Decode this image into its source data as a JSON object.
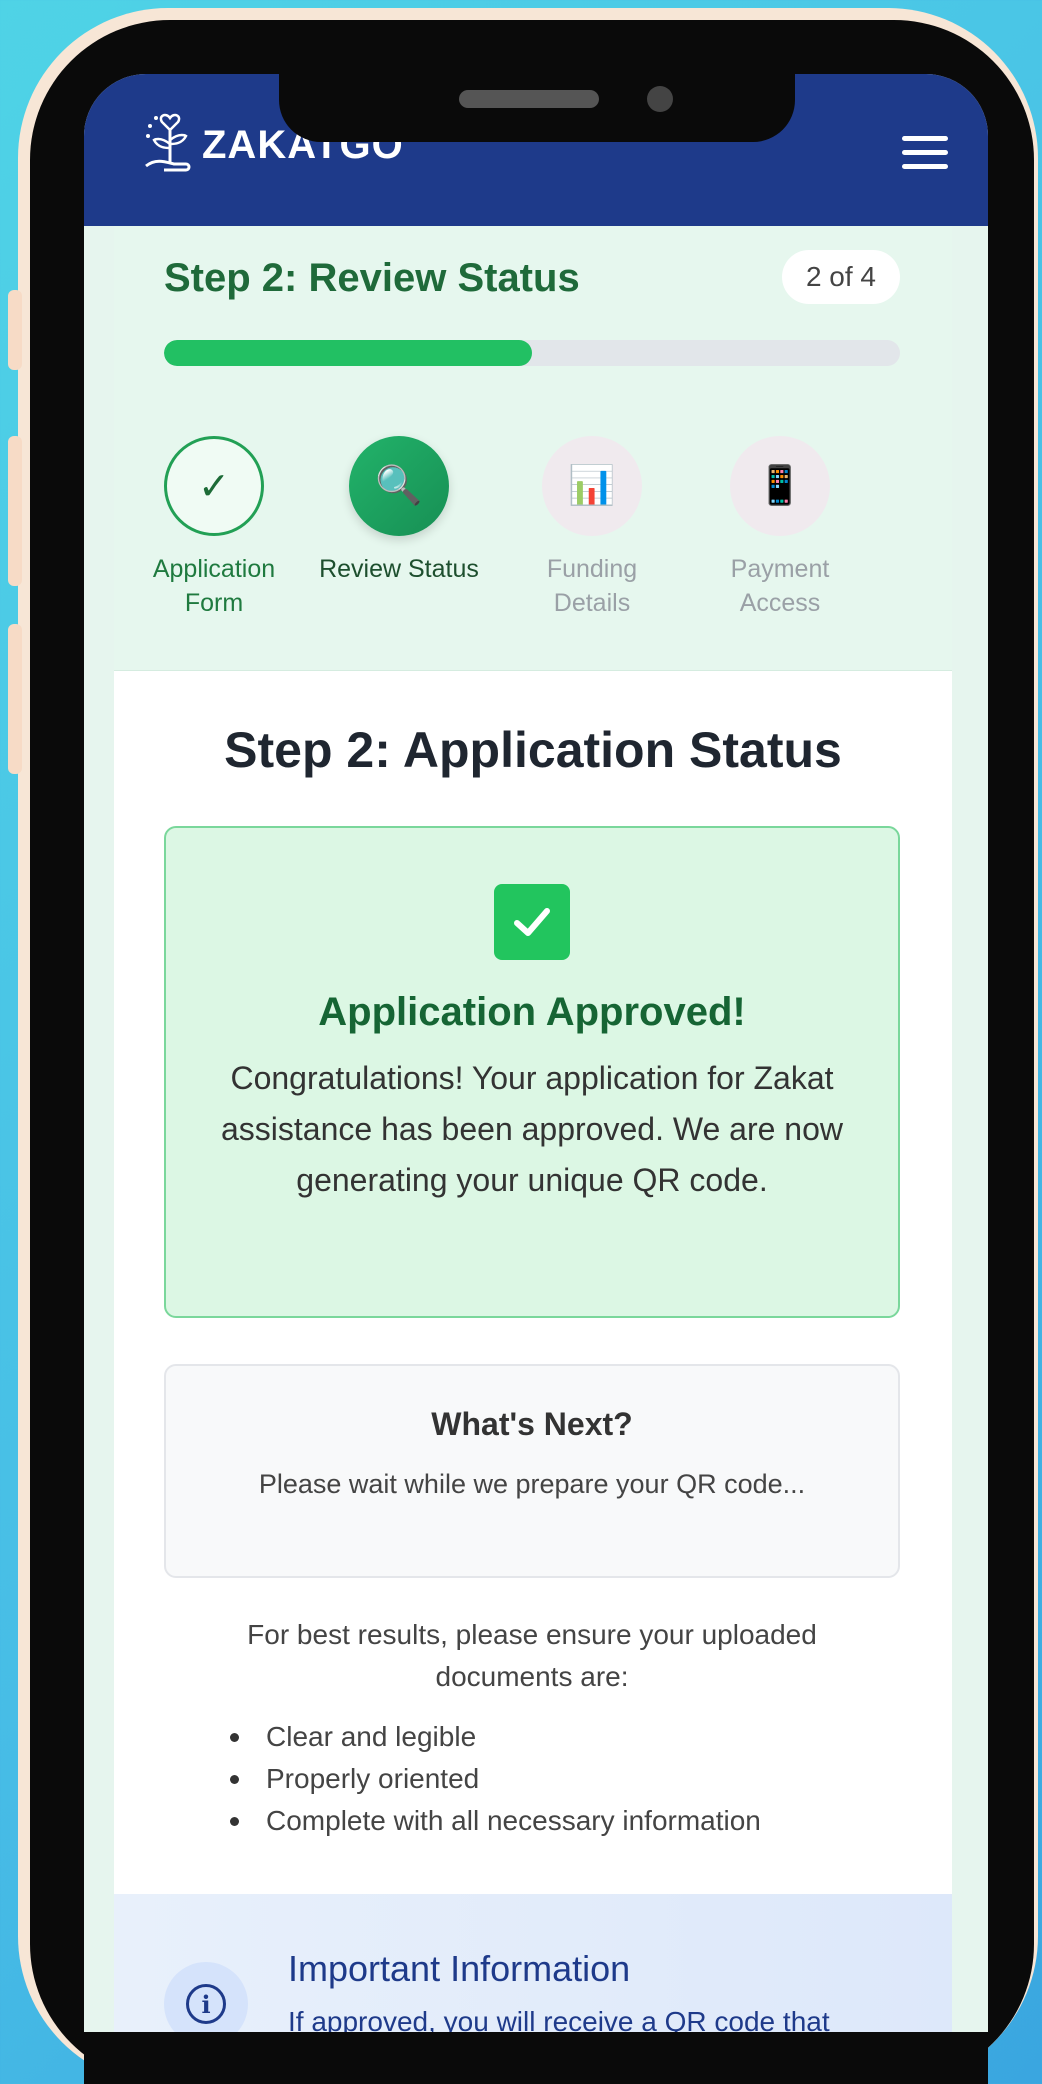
{
  "app": {
    "name": "ZAKATGO",
    "menu_icon": "hamburger-menu-icon"
  },
  "stepper": {
    "title": "Step 2: Review Status",
    "count": "2 of 4",
    "progress_fraction": 0.5,
    "steps": [
      {
        "label": "Application Form",
        "icon": "checkmark-icon",
        "glyph": "✓",
        "state": "done"
      },
      {
        "label": "Review Status",
        "icon": "magnifier-icon",
        "glyph": "🔍",
        "state": "active"
      },
      {
        "label": "Funding Details",
        "icon": "bar-chart-icon",
        "glyph": "📊",
        "state": "pending"
      },
      {
        "label": "Payment Access",
        "icon": "phone-icon",
        "glyph": "📱",
        "state": "pending"
      }
    ]
  },
  "main": {
    "heading": "Step 2: Application Status",
    "approved": {
      "title": "Application Approved!",
      "message": "Congratulations! Your application for Zakat assistance has been approved. We are now generating your unique QR code."
    },
    "next": {
      "title": "What's Next?",
      "message": "Please wait while we prepare your QR code..."
    },
    "tips": {
      "intro": "For best results, please ensure your uploaded documents are:",
      "items": [
        "Clear and legible",
        "Properly oriented",
        "Complete with all necessary information"
      ]
    },
    "info": {
      "title": "Important Information",
      "text": "If approved, you will receive a QR code that"
    }
  },
  "colors": {
    "header": "#1e3a8a",
    "accent_green": "#22c55e",
    "approved_bg": "#dcf7e4"
  }
}
